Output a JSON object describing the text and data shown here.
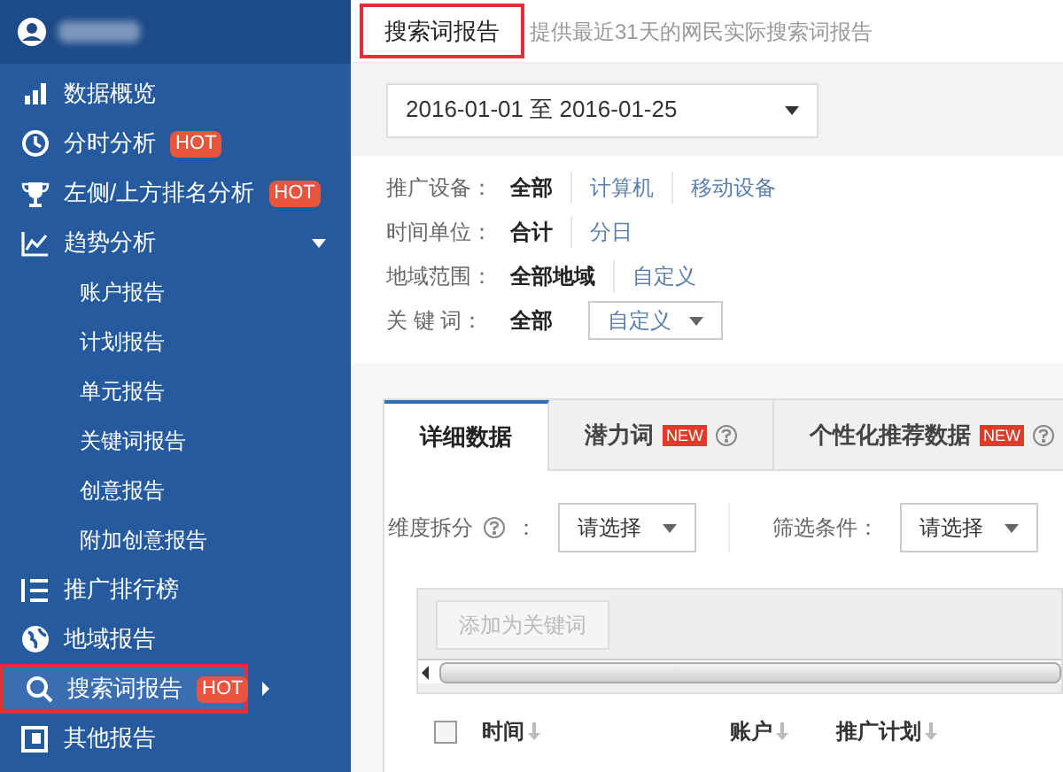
{
  "sidebar": {
    "items": [
      {
        "label": "数据概览",
        "selected": false
      },
      {
        "label": "分时分析",
        "badge": "HOT",
        "selected": false
      },
      {
        "label": "左侧/上方排名分析",
        "badge": "HOT",
        "selected": false
      },
      {
        "label": "趋势分析",
        "expanded": true,
        "selected": false,
        "children": [
          {
            "label": "账户报告"
          },
          {
            "label": "计划报告"
          },
          {
            "label": "单元报告"
          },
          {
            "label": "关键词报告"
          },
          {
            "label": "创意报告"
          },
          {
            "label": "附加创意报告"
          }
        ]
      },
      {
        "label": "推广排行榜",
        "selected": false
      },
      {
        "label": "地域报告",
        "selected": false
      },
      {
        "label": "搜索词报告",
        "badge": "HOT",
        "selected": true,
        "highlighted": true,
        "submenu": true
      },
      {
        "label": "其他报告",
        "selected": false
      }
    ]
  },
  "header": {
    "title": "搜索词报告",
    "title_highlighted": true,
    "description": "提供最近31天的网民实际搜索词报告"
  },
  "date_range": "2016-01-01 至 2016-01-25",
  "filters": [
    {
      "label": "推广设备：",
      "options": [
        {
          "label": "全部",
          "selected": true
        },
        {
          "label": "计算机",
          "selected": false
        },
        {
          "label": "移动设备",
          "selected": false
        }
      ]
    },
    {
      "label": "时间单位：",
      "options": [
        {
          "label": "合计",
          "selected": true
        },
        {
          "label": "分日",
          "selected": false
        }
      ]
    },
    {
      "label": "地域范围：",
      "options": [
        {
          "label": "全部地域",
          "selected": true
        },
        {
          "label": "自定义",
          "selected": false
        }
      ]
    },
    {
      "label": "关 键 词：",
      "options": [
        {
          "label": "全部",
          "selected": true
        },
        {
          "label": "自定义",
          "selected": false,
          "kind": "dropdown"
        }
      ]
    }
  ],
  "tabs": [
    {
      "label": "详细数据",
      "selected": true
    },
    {
      "label": "潜力词",
      "badge": "NEW",
      "help": true,
      "selected": false
    },
    {
      "label": "个性化推荐数据",
      "badge": "NEW",
      "help": true,
      "selected": false
    }
  ],
  "controls": [
    {
      "label": "维度拆分",
      "help": true,
      "colon": "：",
      "value": "请选择"
    },
    {
      "label": "筛选条件：",
      "value": "请选择"
    }
  ],
  "toolbar": {
    "button": "添加为关键词",
    "disabled": true
  },
  "table": {
    "select_all_checked": false,
    "columns": [
      "时间",
      "账户",
      "推广计划"
    ]
  }
}
